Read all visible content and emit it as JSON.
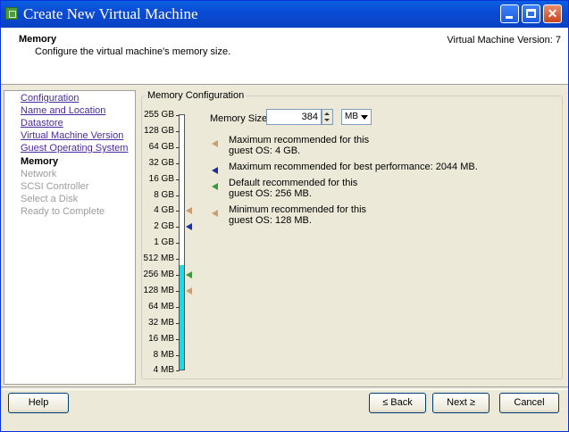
{
  "window": {
    "title": "Create New Virtual Machine",
    "controls": {
      "minimize": "minimize-icon",
      "maximize": "maximize-icon",
      "close": "close-icon"
    }
  },
  "header": {
    "title": "Memory",
    "subtitle": "Configure the virtual machine's memory size.",
    "version": "Virtual Machine Version: 7"
  },
  "nav": {
    "items": [
      {
        "label": "Configuration",
        "state": "link"
      },
      {
        "label": "Name and Location",
        "state": "link"
      },
      {
        "label": "Datastore",
        "state": "link"
      },
      {
        "label": "Virtual Machine Version",
        "state": "link"
      },
      {
        "label": "Guest Operating System",
        "state": "link"
      },
      {
        "label": "Memory",
        "state": "current"
      },
      {
        "label": "Network",
        "state": "disabled"
      },
      {
        "label": "SCSI Controller",
        "state": "disabled"
      },
      {
        "label": "Select a Disk",
        "state": "disabled"
      },
      {
        "label": "Ready to Complete",
        "state": "disabled"
      }
    ]
  },
  "memory": {
    "group_title": "Memory Configuration",
    "size_label": "Memory Size:",
    "size_value": "384",
    "unit": "MB",
    "scale": [
      "255 GB",
      "128 GB",
      "64 GB",
      "32 GB",
      "16 GB",
      "8 GB",
      "4 GB",
      "2 GB",
      "1 GB",
      "512 MB",
      "256 MB",
      "128 MB",
      "64 MB",
      "32 MB",
      "16 MB",
      "8 MB",
      "4 MB"
    ],
    "fill_level_mb": 384,
    "legend": [
      {
        "lines": [
          "Maximum recommended for this",
          "guest OS: 4 GB."
        ],
        "color": "#c8a070",
        "at": "4 GB"
      },
      {
        "lines": [
          "Maximum recommended for best performance: 2044 MB."
        ],
        "color": "#1a2fa0",
        "at": "2 GB"
      },
      {
        "lines": [
          "Default recommended for this",
          "guest OS: 256 MB."
        ],
        "color": "#3a9a3a",
        "at": "256 MB"
      },
      {
        "lines": [
          "Minimum recommended for this",
          "guest OS: 128 MB."
        ],
        "color": "#c8a070",
        "at": "128 MB"
      }
    ]
  },
  "buttons": {
    "help": "Help",
    "back": "≤ Back",
    "next": "Next ≥",
    "cancel": "Cancel"
  }
}
